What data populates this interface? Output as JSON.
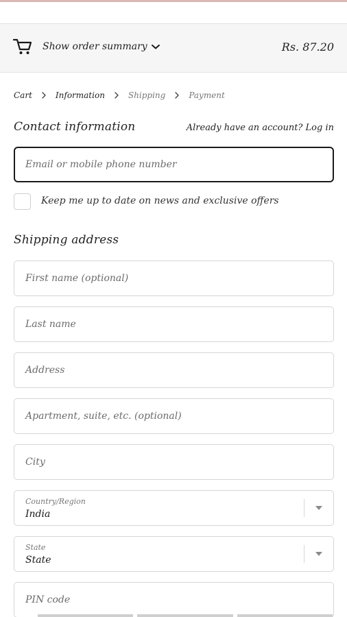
{
  "header": {
    "summary_toggle_label": "Show order summary",
    "total": "Rs. 87.20",
    "icon_cart": "cart-icon",
    "icon_toggle": "chevron-down-icon"
  },
  "breadcrumb": {
    "items": [
      "Cart",
      "Information",
      "Shipping",
      "Payment"
    ],
    "separator_icon": "chevron-right-icon"
  },
  "contact": {
    "title": "Contact information",
    "account_prompt": "Already have an account?",
    "login_label": "Log in",
    "email_placeholder": "Email or mobile phone number",
    "newsletter_label": "Keep me up to date on news and exclusive offers"
  },
  "shipping": {
    "title": "Shipping address",
    "first_name_placeholder": "First name (optional)",
    "last_name_placeholder": "Last name",
    "address_placeholder": "Address",
    "apartment_placeholder": "Apartment, suite, etc. (optional)",
    "city_placeholder": "City",
    "country_label": "Country/Region",
    "country_value": "India",
    "state_label": "State",
    "state_value": "State",
    "pin_placeholder": "PIN code"
  },
  "colors": {
    "accent": "#1a1a1a",
    "summary_bg": "#f6f6f6",
    "field_border": "#d6d6d6"
  }
}
